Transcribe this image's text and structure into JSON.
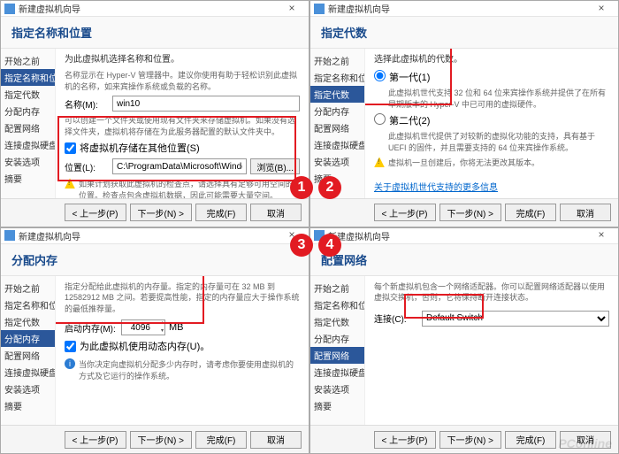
{
  "window_title": "新建虚拟机向导",
  "sidebar": {
    "items": [
      "开始之前",
      "指定名称和位置",
      "指定代数",
      "分配内存",
      "配置网络",
      "连接虚拟硬盘",
      "安装选项",
      "摘要"
    ]
  },
  "pane1": {
    "heading": "指定名称和位置",
    "desc": "为此虚拟机选择名称和位置。",
    "desc2": "名称显示在 Hyper-V 管理器中。建议你使用有助于轻松识别此虚拟机的名称，如来宾操作系统或负载的名称。",
    "name_label": "名称(M):",
    "name_value": "win10",
    "desc3": "可以创建一个文件夹或使用现有文件夹来存储虚拟机。如果没有选择文件夹，虚拟机将存储在为此服务器配置的默认文件夹中。",
    "store_check_label": "将虚拟机存储在其他位置(S)",
    "loc_label": "位置(L):",
    "loc_value": "C:\\ProgramData\\Microsoft\\Windows\\Hyper-V\\",
    "browse": "浏览(B)...",
    "warn": "如果计划获取此虚拟机的检查点，请选择具有足够可用空间的位置。检查点包含虚拟机数据，因此可能需要大量空间。"
  },
  "pane2": {
    "heading": "指定代数",
    "desc": "选择此虚拟机的代数。",
    "gen1_label": "第一代(1)",
    "gen1_desc": "此虚拟机世代支持 32 位和 64 位来宾操作系统并提供了在所有早期版本的 Hyper-V 中已可用的虚拟硬件。",
    "gen2_label": "第二代(2)",
    "gen2_desc": "此虚拟机世代提供了对较新的虚拟化功能的支持，具有基于 UEFI 的固件，并且需要支持的 64 位来宾操作系统。",
    "warn": "虚拟机一旦创建后，你将无法更改其版本。",
    "link": "关于虚拟机世代支持的更多信息"
  },
  "pane3": {
    "heading": "分配内存",
    "desc": "指定分配给此虚拟机的内存量。指定的内存量可在 32 MB 到 12582912 MB 之间。若要提高性能，指定的内存量应大于操作系统的最低推荐量。",
    "mem_label": "启动内存(M):",
    "mem_value": "4096",
    "mem_unit": "MB",
    "dyn_label": "为此虚拟机使用动态内存(U)。",
    "info": "当你决定向虚拟机分配多少内存时，请考虑你要使用虚拟机的方式及它运行的操作系统。"
  },
  "pane4": {
    "heading": "配置网络",
    "desc": "每个新虚拟机包含一个网络适配器。你可以配置网络适配器以使用虚拟交换机，否则，它将保持断开连接状态。",
    "conn_label": "连接(C):",
    "conn_value": "Default Switch"
  },
  "buttons": {
    "prev": "< 上一步(P)",
    "next": "下一步(N) >",
    "finish": "完成(F)",
    "cancel": "取消"
  },
  "watermark": "PConline"
}
